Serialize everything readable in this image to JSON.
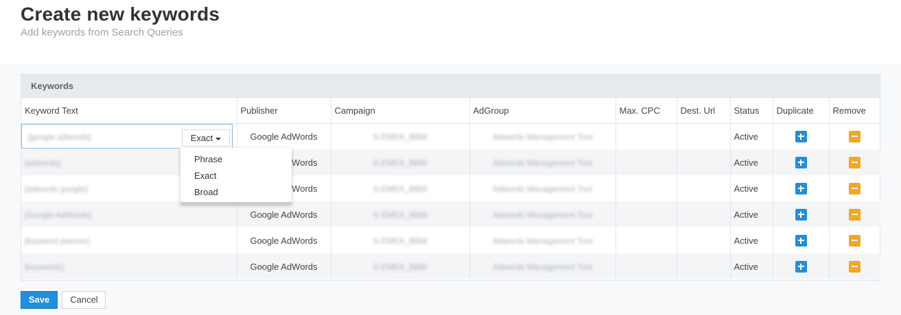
{
  "header": {
    "title": "Create new keywords",
    "subtitle": "Add keywords from Search Queries"
  },
  "panel": {
    "title": "Keywords"
  },
  "columns": [
    "Keyword Text",
    "Publisher",
    "Campaign",
    "AdGroup",
    "Max. CPC",
    "Dest. Url",
    "Status",
    "Duplicate",
    "Remove"
  ],
  "rows": [
    {
      "keyword": "[google adwords]",
      "publisher": "Google AdWords",
      "campaign": "S-EMEA_BBM",
      "adgroup": "Adwords Management Tool",
      "max_cpc": "",
      "dest_url": "",
      "status": "Active"
    },
    {
      "keyword": "[adwords]",
      "publisher": "Google AdWords",
      "campaign": "S-EMEA_BBM",
      "adgroup": "Adwords Management Tool",
      "max_cpc": "",
      "dest_url": "",
      "status": "Active"
    },
    {
      "keyword": "[adwords google]",
      "publisher": "Google AdWords",
      "campaign": "S-EMEA_BBM",
      "adgroup": "Adwords Management Tool",
      "max_cpc": "",
      "dest_url": "",
      "status": "Active"
    },
    {
      "keyword": "[Google AdWords]",
      "publisher": "Google AdWords",
      "campaign": "S-EMEA_BBM",
      "adgroup": "Adwords Management Tool",
      "max_cpc": "",
      "dest_url": "",
      "status": "Active"
    },
    {
      "keyword": "[keyword planner]",
      "publisher": "Google AdWords",
      "campaign": "S-EMEA_BBM",
      "adgroup": "Adwords Management Tool",
      "max_cpc": "",
      "dest_url": "",
      "status": "Active"
    },
    {
      "keyword": "[keywords]",
      "publisher": "Google AdWords",
      "campaign": "S-EMEA_BBM",
      "adgroup": "Adwords Management Tool",
      "max_cpc": "",
      "dest_url": "",
      "status": "Active"
    }
  ],
  "match_type": {
    "selected": "Exact",
    "options": [
      "Phrase",
      "Exact",
      "Broad"
    ]
  },
  "actions": {
    "save_label": "Save",
    "cancel_label": "Cancel"
  },
  "icons": {
    "duplicate": "plus-icon",
    "remove": "minus-icon"
  },
  "colors": {
    "primary": "#1f8fde",
    "warning": "#f5a623"
  }
}
